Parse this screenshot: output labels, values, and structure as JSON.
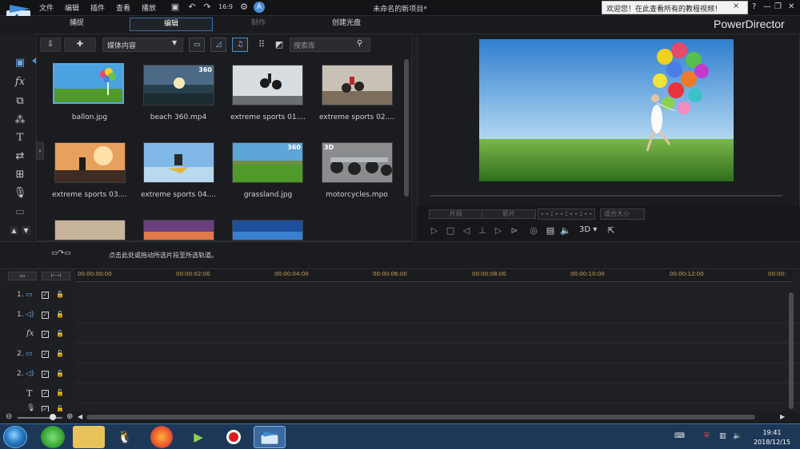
{
  "titlebar": {
    "menus": [
      "文件",
      "编辑",
      "插件",
      "查看",
      "播放"
    ],
    "doc_title": "未命名的新项目*",
    "notice": "欢迎您！在此查看所有的教程视频！",
    "notice_close": "×",
    "help": "?",
    "minimize": "—",
    "restore": "❐",
    "close": "✕"
  },
  "modes": {
    "capture": "捕捉",
    "edit": "编辑",
    "produce": "制作",
    "disc": "创建光盘"
  },
  "brand": "PowerDirector",
  "library": {
    "media_select": "媒体内容",
    "search_placeholder": "搜索库",
    "items": [
      {
        "label": "ballon.jpg",
        "badge": ""
      },
      {
        "label": "beach 360.mp4",
        "badge": "360"
      },
      {
        "label": "extreme sports 01....",
        "badge": ""
      },
      {
        "label": "extreme sports 02....",
        "badge": ""
      },
      {
        "label": "extreme sports 03....",
        "badge": ""
      },
      {
        "label": "extreme sports 04....",
        "badge": ""
      },
      {
        "label": "grassland.jpg",
        "badge": "360"
      },
      {
        "label": "motorcycles.mpo",
        "badge": "3D"
      }
    ]
  },
  "preview": {
    "clip_btn": "片段",
    "movie_btn": "影片",
    "timecode": "- - : - - : - - : - -",
    "fit": "适合大小",
    "mode_3d": "3D"
  },
  "strip": {
    "hint": "点击此处或拖动所选片段至所选轨道。"
  },
  "timeline": {
    "ticks": [
      "00:00:00:00",
      "00:00:02:00",
      "00:00:04:00",
      "00:00:06:00",
      "00:00:08:00",
      "00:00:10:00",
      "00:00:12:00",
      "00:00:"
    ],
    "tracks": [
      {
        "num": "1.",
        "kind": "video"
      },
      {
        "num": "1.",
        "kind": "audio"
      },
      {
        "num": "",
        "kind": "fx"
      },
      {
        "num": "2.",
        "kind": "video"
      },
      {
        "num": "2.",
        "kind": "audio"
      },
      {
        "num": "",
        "kind": "title"
      },
      {
        "num": "",
        "kind": "voice"
      }
    ]
  },
  "taskbar": {
    "time": "19:41",
    "date": "2018/12/15"
  },
  "colors": {
    "accent": "#3a6ea5",
    "ruler_text": "#c9a45a",
    "selection": "#5aa6f0"
  }
}
